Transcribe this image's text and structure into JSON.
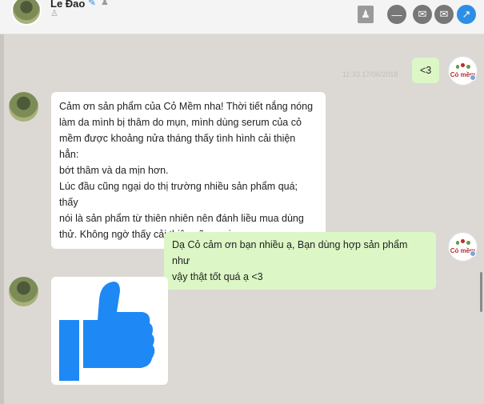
{
  "header": {
    "contact_name": "Le Đao",
    "leaf_icon": "leaf-icon",
    "cake_icon": "cake-icon",
    "user_icon": "user-icon",
    "clipboard_icon": "clipboard-icon",
    "actions": [
      {
        "name": "minus-icon",
        "glyph": "—"
      },
      {
        "name": "mail-icon",
        "glyph": "✉"
      },
      {
        "name": "mail-forward-icon",
        "glyph": "✉"
      },
      {
        "name": "open-icon",
        "glyph": "↗"
      }
    ]
  },
  "messages": [
    {
      "from": "me",
      "text": "<3",
      "timestamp": "11:33 17/06/2018"
    },
    {
      "from": "them",
      "lines": [
        "Cảm ơn sản phẩm của Cỏ Mềm nha! Thời tiết nắng nóng",
        "làm da mình bị thâm do mụn, mình dùng serum của cỏ",
        "mềm được khoảng nửa tháng thấy tình hình cải thiện hẳn:",
        "bớt thâm và da mịn hơn.",
        "Lúc đầu cũng ngại do thị trường nhiều sản phẩm quá; thấy",
        "nói là sản phẩm từ thiên nhiên nên đánh liều mua dùng",
        "thử. Không ngờ thấy cải thiện cũng vui."
      ]
    },
    {
      "from": "me",
      "lines": [
        "Dạ Cỏ cảm ơn bạn nhiều ạ, Bạn dùng hợp sản phẩm như",
        "vậy thật tốt quá ạ <3"
      ]
    },
    {
      "from": "them",
      "sticker": "thumbs-up-icon"
    }
  ],
  "brand": {
    "text": "Cỏ mềm"
  },
  "colors": {
    "outgoing_bubble": "#dcf7c5",
    "incoming_bubble": "#ffffff",
    "chat_background": "#dcd9d5",
    "thumb": "#1e88f5"
  }
}
